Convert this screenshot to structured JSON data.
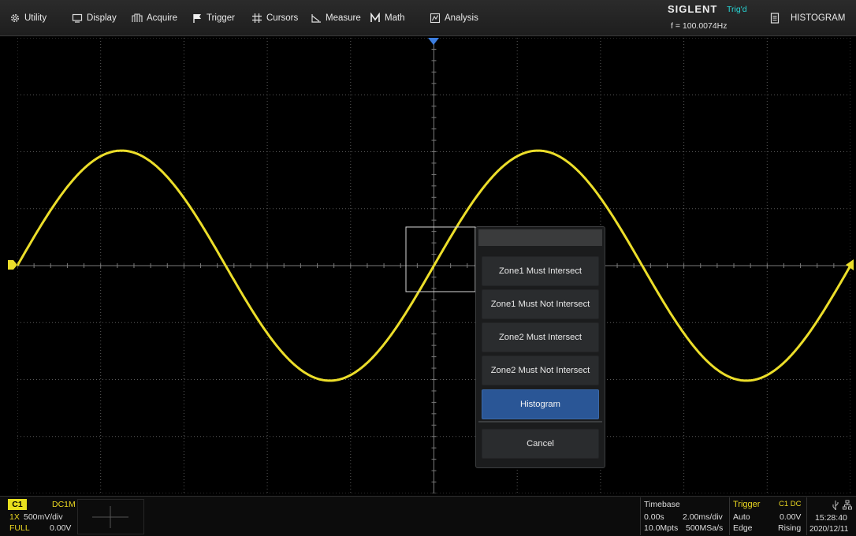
{
  "menu": [
    {
      "label": "Utility",
      "icon": "gear-icon"
    },
    {
      "label": "Display",
      "icon": "monitor-icon"
    },
    {
      "label": "Acquire",
      "icon": "acquire-icon"
    },
    {
      "label": "Trigger",
      "icon": "flag-icon"
    },
    {
      "label": "Cursors",
      "icon": "cursors-icon"
    },
    {
      "label": "Measure",
      "icon": "measure-icon"
    },
    {
      "label": "Math",
      "icon": "math-icon"
    },
    {
      "label": "Analysis",
      "icon": "analysis-icon"
    }
  ],
  "header": {
    "brand": "SIGLENT",
    "trigger_status": "Trig'd",
    "frequency": "f = 100.0074Hz",
    "mode_title": "HISTOGRAM"
  },
  "popup": {
    "buttons": [
      {
        "label": "Zone1 Must Intersect",
        "active": false
      },
      {
        "label": "Zone1 Must Not Intersect",
        "active": false
      },
      {
        "label": "Zone2 Must Intersect",
        "active": false
      },
      {
        "label": "Zone2 Must Not Intersect",
        "active": false
      },
      {
        "label": "Histogram",
        "active": true
      }
    ],
    "cancel_label": "Cancel"
  },
  "channel1": {
    "name": "C1",
    "coupling": "DC1M",
    "probe": "1X",
    "scale": "500mV/div",
    "bandwidth": "FULL",
    "offset": "0.00V"
  },
  "timebase": {
    "title": "Timebase",
    "delay": "0.00s",
    "scale": "2.00ms/div",
    "memory": "10.0Mpts",
    "sample_rate": "500MSa/s"
  },
  "trigger": {
    "title": "Trigger",
    "source": "C1 DC",
    "mode": "Auto",
    "level": "0.00V",
    "type": "Edge",
    "slope": "Rising"
  },
  "clock": {
    "time": "15:28:40",
    "date": "2020/12/11"
  },
  "colors": {
    "trace": "#ecde2a",
    "accent_blue": "#2a5696",
    "trig_status": "#27d4d4"
  }
}
